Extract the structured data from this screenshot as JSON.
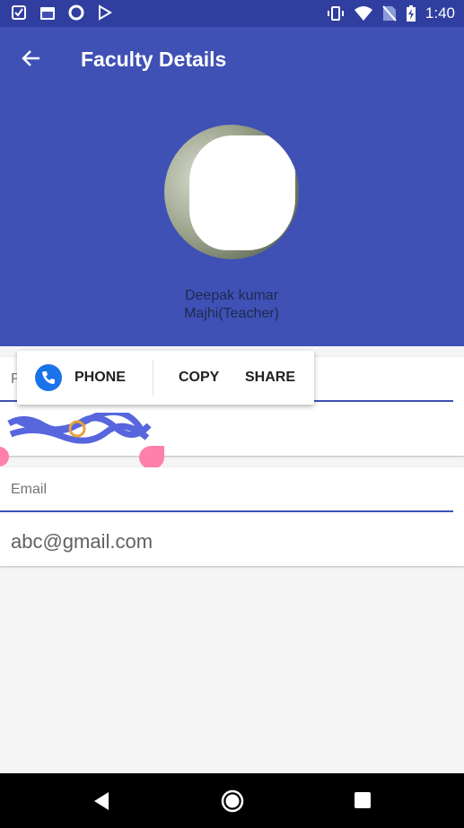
{
  "status_bar": {
    "time": "1:40",
    "left_icons": [
      "checklist-icon",
      "calendar-icon",
      "circle-icon",
      "play-store-icon"
    ],
    "right_icons": [
      "vibrate-icon",
      "wifi-icon",
      "no-sim-icon",
      "battery-charging-icon"
    ]
  },
  "app_bar": {
    "title": "Faculty Details",
    "background": "#3f51b5"
  },
  "profile": {
    "name": "Deepak kumar Majhi(Teacher)"
  },
  "phone_field": {
    "label": "P",
    "value": ""
  },
  "email_field": {
    "label": "Email",
    "value": "abc@gmail.com"
  },
  "selection_popup": {
    "phone_label": "PHONE",
    "copy_label": "COPY",
    "share_label": "SHARE"
  },
  "nav_bar": {
    "icons": [
      "back-icon",
      "home-icon",
      "recents-icon"
    ]
  }
}
